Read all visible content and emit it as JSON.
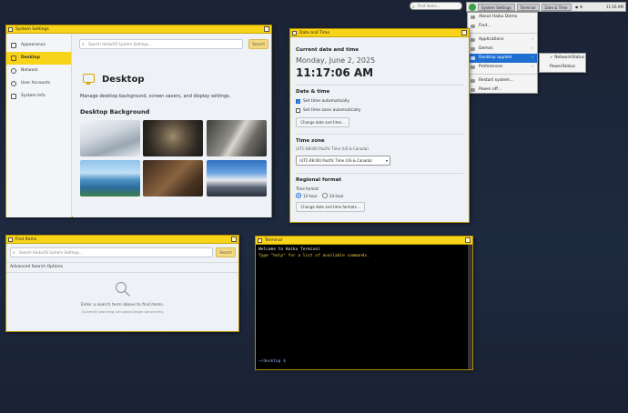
{
  "topbar": {
    "find_placeholder": "Find items...",
    "tabs": [
      "System Settings",
      "Terminal",
      "Date & Time"
    ],
    "tray_vol": "◀",
    "tray_net": "⚙",
    "clock": "11:16 AM"
  },
  "menu": {
    "items": [
      {
        "label": "About Haiku Demo",
        "arrow": ""
      },
      {
        "label": "Find...",
        "arrow": ""
      },
      {
        "label": "Applications",
        "arrow": "›"
      },
      {
        "label": "Demos",
        "arrow": "›"
      },
      {
        "label": "Desktop applets",
        "arrow": "›"
      },
      {
        "label": "Preferences",
        "arrow": "›"
      },
      {
        "label": "Restart system...",
        "arrow": ""
      },
      {
        "label": "Power off...",
        "arrow": ""
      }
    ],
    "submenu": [
      "✓ NetworkStatus",
      "PowerStatus"
    ]
  },
  "system_settings": {
    "title": "System Settings",
    "sidebar": [
      "Appearance",
      "Desktop",
      "Network",
      "User Accounts",
      "System Info"
    ],
    "search_placeholder": "Search HaikuOS System Settings...",
    "search_button": "Search",
    "page_title": "Desktop",
    "description": "Manage desktop background, screen savers, and display settings.",
    "bg_title": "Desktop Background"
  },
  "date_time": {
    "title": "Date and Time",
    "current_heading": "Current date and time",
    "date": "Monday, June 2, 2025",
    "time": "11:17:06 AM",
    "dt_heading": "Date & time",
    "auto_time": "Set time automatically",
    "auto_tz": "Set time zone automatically",
    "change_btn": "Change date and time...",
    "tz_heading": "Time zone",
    "tz_current": "(UTC-08:00) Pacific Time (US & Canada)",
    "tz_select": "(UTC-08:00) Pacific Time (US & Canada)",
    "regional_heading": "Regional format",
    "time_format_label": "Time format:",
    "h12": "12-hour",
    "h24": "24-hour",
    "formats_btn": "Change date and time formats..."
  },
  "find_items": {
    "title": "Find Items",
    "search_placeholder": "Search HaikuOS System Settings...",
    "search_button": "Search",
    "advanced": "Advanced Search Options",
    "empty_main": "Enter a search term above to find items.",
    "empty_sub": "(Currently searching: simulated design documents)"
  },
  "terminal": {
    "title": "Terminal",
    "line1": "Welcome to Haiku Terminal",
    "line2": "Type \"help\" for a list of available commands.",
    "prompt": "~/desktop $"
  }
}
